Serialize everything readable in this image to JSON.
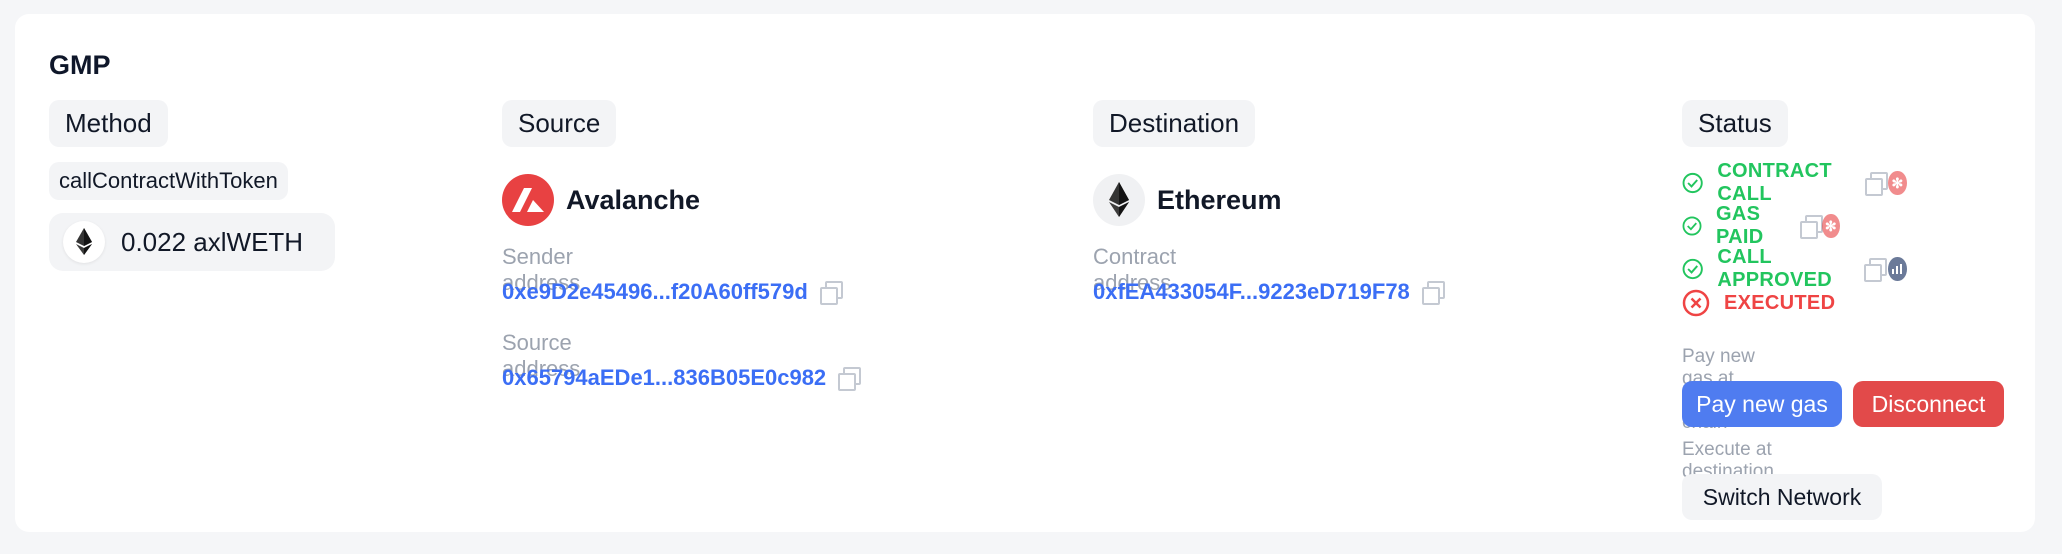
{
  "section_title": "GMP",
  "method": {
    "header": "Method",
    "name": "callContractWithToken",
    "amount": "0.022 axlWETH",
    "amount_icon": "ethereum-icon"
  },
  "source": {
    "header": "Source",
    "chain": "Avalanche",
    "chain_icon": "avalanche-icon",
    "sender_label": "Sender address",
    "sender_address": "0xe9D2e45496...f20A60ff579d",
    "source_label": "Source address",
    "source_address": "0x65794aEDe1...836B05E0c982"
  },
  "destination": {
    "header": "Destination",
    "chain": "Ethereum",
    "chain_icon": "ethereum-icon",
    "contract_label": "Contract address",
    "contract_address": "0xfEA433054F...9223eD719F78"
  },
  "status": {
    "header": "Status",
    "steps": [
      {
        "label": "CONTRACT CALL",
        "state": "success",
        "explorer_icon": "snowtrace-icon"
      },
      {
        "label": "GAS PAID",
        "state": "success",
        "explorer_icon": "snowtrace-icon"
      },
      {
        "label": "CALL APPROVED",
        "state": "success",
        "explorer_icon": "axelarscan-icon"
      },
      {
        "label": "EXECUTED",
        "state": "failed"
      }
    ],
    "pay_gas_label": "Pay new gas at source chain",
    "pay_gas_button": "Pay new gas",
    "disconnect_button": "Disconnect",
    "execute_label": "Execute at destination chain",
    "switch_network_button": "Switch Network"
  },
  "colors": {
    "success": "#22c55e",
    "failed": "#ef4444",
    "link": "#3b6ef5",
    "primary_button": "#4f7cf0",
    "danger_button": "#e24a4a",
    "avalanche": "#e84142"
  }
}
